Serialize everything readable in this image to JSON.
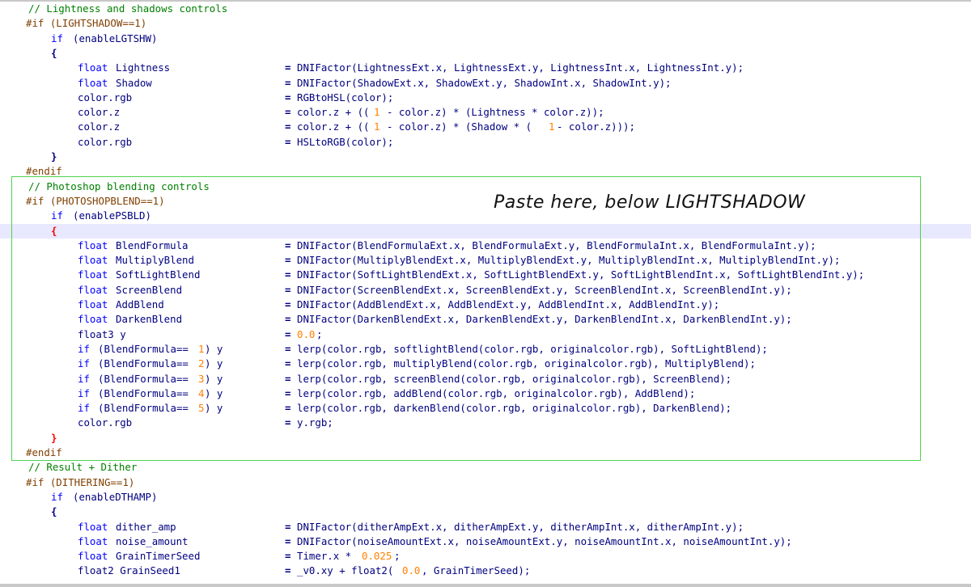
{
  "annotation": {
    "text": "Paste here, below LIGHTSHADOW",
    "box_color": "#4fd24f"
  },
  "colors": {
    "comment": "#008000",
    "preprocessor": "#804000",
    "keyword": "#0000ff",
    "identifier": "#000080",
    "number": "#ff8000",
    "matched_brace": "#ff0000",
    "current_line": "#e8e8ff"
  },
  "current_line_index": 15,
  "lines": [
    {
      "segs": [
        {
          "t": "// Lightness and shadows controls",
          "c": "cm",
          "col": 35
        }
      ]
    },
    {
      "segs": [
        {
          "t": "#if (LIGHTSHADOW==1)",
          "c": "pp",
          "col": 32
        }
      ]
    },
    {
      "segs": [
        {
          "t": "if",
          "c": "kw",
          "col": 63
        },
        {
          "t": "(enableLGTSHW)",
          "c": "id",
          "col": 90
        }
      ]
    },
    {
      "segs": [
        {
          "t": "{",
          "c": "br",
          "col": 63
        }
      ]
    },
    {
      "segs": [
        {
          "t": "float",
          "c": "tp",
          "col": 96
        },
        {
          "t": "Lightness",
          "c": "id",
          "col": 143
        },
        {
          "t": "=",
          "c": "op",
          "col": 352
        },
        {
          "t": "DNIFactor(LightnessExt.x, LightnessExt.y, LightnessInt.x, LightnessInt.y);",
          "c": "id",
          "col": 367
        }
      ]
    },
    {
      "segs": [
        {
          "t": "float",
          "c": "tp",
          "col": 96
        },
        {
          "t": "Shadow",
          "c": "id",
          "col": 143
        },
        {
          "t": "=",
          "c": "op",
          "col": 352
        },
        {
          "t": "DNIFactor(ShadowExt.x, ShadowExt.y, ShadowInt.x, ShadowInt.y);",
          "c": "id",
          "col": 367
        }
      ]
    },
    {
      "segs": [
        {
          "t": "color.rgb",
          "c": "id",
          "col": 96
        },
        {
          "t": "=",
          "c": "op",
          "col": 352
        },
        {
          "t": "RGBtoHSL(color);",
          "c": "id",
          "col": 367
        }
      ]
    },
    {
      "segs": [
        {
          "t": "color.z",
          "c": "id",
          "col": 96
        },
        {
          "t": "=",
          "c": "op",
          "col": 352
        },
        {
          "t": "color.z + ((",
          "c": "id",
          "col": 367
        },
        {
          "t": "1",
          "c": "num",
          "col": 462
        },
        {
          "t": "- color.z) * (Lightness * color.z));",
          "c": "id",
          "col": 478
        }
      ]
    },
    {
      "segs": [
        {
          "t": "color.z",
          "c": "id",
          "col": 96
        },
        {
          "t": "=",
          "c": "op",
          "col": 352
        },
        {
          "t": "color.z + ((",
          "c": "id",
          "col": 367
        },
        {
          "t": "1",
          "c": "num",
          "col": 462
        },
        {
          "t": "- color.z) * (Shadow * (",
          "c": "id",
          "col": 478
        },
        {
          "t": "1",
          "c": "num",
          "col": 678
        },
        {
          "t": "- color.z)));",
          "c": "id",
          "col": 688
        }
      ]
    },
    {
      "segs": [
        {
          "t": "color.rgb",
          "c": "id",
          "col": 96
        },
        {
          "t": "=",
          "c": "op",
          "col": 352
        },
        {
          "t": "HSLtoRGB(color);",
          "c": "id",
          "col": 367
        }
      ]
    },
    {
      "segs": [
        {
          "t": "}",
          "c": "br",
          "col": 63
        }
      ]
    },
    {
      "segs": [
        {
          "t": "#endif",
          "c": "pp",
          "col": 32
        }
      ]
    },
    {
      "segs": [
        {
          "t": "// Photoshop blending controls",
          "c": "cm",
          "col": 35
        }
      ]
    },
    {
      "segs": [
        {
          "t": "#if (PHOTOSHOPBLEND==1)",
          "c": "pp",
          "col": 32
        }
      ]
    },
    {
      "segs": [
        {
          "t": "if",
          "c": "kw",
          "col": 63
        },
        {
          "t": "(enablePSBLD)",
          "c": "id",
          "col": 90
        }
      ]
    },
    {
      "segs": [
        {
          "t": "{",
          "c": "brhl",
          "col": 63
        }
      ]
    },
    {
      "segs": [
        {
          "t": "float",
          "c": "tp",
          "col": 96
        },
        {
          "t": "BlendFormula",
          "c": "id",
          "col": 143
        },
        {
          "t": "=",
          "c": "op",
          "col": 352
        },
        {
          "t": "DNIFactor(BlendFormulaExt.x, BlendFormulaExt.y, BlendFormulaInt.x, BlendFormulaInt.y);",
          "c": "id",
          "col": 367
        }
      ]
    },
    {
      "segs": [
        {
          "t": "float",
          "c": "tp",
          "col": 96
        },
        {
          "t": "MultiplyBlend",
          "c": "id",
          "col": 143
        },
        {
          "t": "=",
          "c": "op",
          "col": 352
        },
        {
          "t": "DNIFactor(MultiplyBlendExt.x, MultiplyBlendExt.y, MultiplyBlendInt.x, MultiplyBlendInt.y);",
          "c": "id",
          "col": 367
        }
      ]
    },
    {
      "segs": [
        {
          "t": "float",
          "c": "tp",
          "col": 96
        },
        {
          "t": "SoftLightBlend",
          "c": "id",
          "col": 143
        },
        {
          "t": "=",
          "c": "op",
          "col": 352
        },
        {
          "t": "DNIFactor(SoftLightBlendExt.x, SoftLightBlendExt.y, SoftLightBlendInt.x, SoftLightBlendInt.y);",
          "c": "id",
          "col": 367
        }
      ]
    },
    {
      "segs": [
        {
          "t": "float",
          "c": "tp",
          "col": 96
        },
        {
          "t": "ScreenBlend",
          "c": "id",
          "col": 143
        },
        {
          "t": "=",
          "c": "op",
          "col": 352
        },
        {
          "t": "DNIFactor(ScreenBlendExt.x, ScreenBlendExt.y, ScreenBlendInt.x, ScreenBlendInt.y);",
          "c": "id",
          "col": 367
        }
      ]
    },
    {
      "segs": [
        {
          "t": "float",
          "c": "tp",
          "col": 96
        },
        {
          "t": "AddBlend",
          "c": "id",
          "col": 143
        },
        {
          "t": "=",
          "c": "op",
          "col": 352
        },
        {
          "t": "DNIFactor(AddBlendExt.x, AddBlendExt.y, AddBlendInt.x, AddBlendInt.y);",
          "c": "id",
          "col": 367
        }
      ]
    },
    {
      "segs": [
        {
          "t": "float",
          "c": "tp",
          "col": 96
        },
        {
          "t": "DarkenBlend",
          "c": "id",
          "col": 143
        },
        {
          "t": "=",
          "c": "op",
          "col": 352
        },
        {
          "t": "DNIFactor(DarkenBlendExt.x, DarkenBlendExt.y, DarkenBlendInt.x, DarkenBlendInt.y);",
          "c": "id",
          "col": 367
        }
      ]
    },
    {
      "segs": [
        {
          "t": "float3 y",
          "c": "id",
          "col": 96
        },
        {
          "t": "=",
          "c": "op",
          "col": 352
        },
        {
          "t": "0.0",
          "c": "num",
          "col": 367
        },
        {
          "t": ";",
          "c": "id",
          "col": 391
        }
      ]
    },
    {
      "segs": [
        {
          "t": "if",
          "c": "kw",
          "col": 96
        },
        {
          "t": "(BlendFormula==",
          "c": "id",
          "col": 121
        },
        {
          "t": "1",
          "c": "num",
          "col": 245
        },
        {
          "t": ") y",
          "c": "id",
          "col": 253
        },
        {
          "t": "=",
          "c": "op",
          "col": 352
        },
        {
          "t": "lerp(color.rgb, softlightBlend(color.rgb, originalcolor.rgb), SoftLightBlend);",
          "c": "id",
          "col": 367
        }
      ]
    },
    {
      "segs": [
        {
          "t": "if",
          "c": "kw",
          "col": 96
        },
        {
          "t": "(BlendFormula==",
          "c": "id",
          "col": 121
        },
        {
          "t": "2",
          "c": "num",
          "col": 245
        },
        {
          "t": ") y",
          "c": "id",
          "col": 253
        },
        {
          "t": "=",
          "c": "op",
          "col": 352
        },
        {
          "t": "lerp(color.rgb, multiplyBlend(color.rgb, originalcolor.rgb), MultiplyBlend);",
          "c": "id",
          "col": 367
        }
      ]
    },
    {
      "segs": [
        {
          "t": "if",
          "c": "kw",
          "col": 96
        },
        {
          "t": "(BlendFormula==",
          "c": "id",
          "col": 121
        },
        {
          "t": "3",
          "c": "num",
          "col": 245
        },
        {
          "t": ") y",
          "c": "id",
          "col": 253
        },
        {
          "t": "=",
          "c": "op",
          "col": 352
        },
        {
          "t": "lerp(color.rgb, screenBlend(color.rgb, originalcolor.rgb), ScreenBlend);",
          "c": "id",
          "col": 367
        }
      ]
    },
    {
      "segs": [
        {
          "t": "if",
          "c": "kw",
          "col": 96
        },
        {
          "t": "(BlendFormula==",
          "c": "id",
          "col": 121
        },
        {
          "t": "4",
          "c": "num",
          "col": 245
        },
        {
          "t": ") y",
          "c": "id",
          "col": 253
        },
        {
          "t": "=",
          "c": "op",
          "col": 352
        },
        {
          "t": "lerp(color.rgb, addBlend(color.rgb, originalcolor.rgb), AddBlend);",
          "c": "id",
          "col": 367
        }
      ]
    },
    {
      "segs": [
        {
          "t": "if",
          "c": "kw",
          "col": 96
        },
        {
          "t": "(BlendFormula==",
          "c": "id",
          "col": 121
        },
        {
          "t": "5",
          "c": "num",
          "col": 245
        },
        {
          "t": ") y",
          "c": "id",
          "col": 253
        },
        {
          "t": "=",
          "c": "op",
          "col": 352
        },
        {
          "t": "lerp(color.rgb, darkenBlend(color.rgb, originalcolor.rgb), DarkenBlend);",
          "c": "id",
          "col": 367
        }
      ]
    },
    {
      "segs": [
        {
          "t": "color.rgb",
          "c": "id",
          "col": 96
        },
        {
          "t": "=",
          "c": "op",
          "col": 352
        },
        {
          "t": "y.rgb;",
          "c": "id",
          "col": 367
        }
      ]
    },
    {
      "segs": [
        {
          "t": "}",
          "c": "brhl",
          "col": 63
        }
      ]
    },
    {
      "segs": [
        {
          "t": "#endif",
          "c": "pp",
          "col": 32
        }
      ]
    },
    {
      "segs": [
        {
          "t": "// Result + Dither",
          "c": "cm",
          "col": 35
        }
      ]
    },
    {
      "segs": [
        {
          "t": "#if (DITHERING==1)",
          "c": "pp",
          "col": 32
        }
      ]
    },
    {
      "segs": [
        {
          "t": "if",
          "c": "kw",
          "col": 63
        },
        {
          "t": "(enableDTHAMP)",
          "c": "id",
          "col": 90
        }
      ]
    },
    {
      "segs": [
        {
          "t": "{",
          "c": "br",
          "col": 63
        }
      ]
    },
    {
      "segs": [
        {
          "t": "float",
          "c": "tp",
          "col": 96
        },
        {
          "t": "dither_amp",
          "c": "id",
          "col": 143
        },
        {
          "t": "=",
          "c": "op",
          "col": 352
        },
        {
          "t": "DNIFactor(ditherAmpExt.x, ditherAmpExt.y, ditherAmpInt.x, ditherAmpInt.y);",
          "c": "id",
          "col": 367
        }
      ]
    },
    {
      "segs": [
        {
          "t": "float",
          "c": "tp",
          "col": 96
        },
        {
          "t": "noise_amount",
          "c": "id",
          "col": 143
        },
        {
          "t": "=",
          "c": "op",
          "col": 352
        },
        {
          "t": "DNIFactor(noiseAmountExt.x, noiseAmountExt.y, noiseAmountInt.x, noiseAmountInt.y);",
          "c": "id",
          "col": 367
        }
      ]
    },
    {
      "segs": [
        {
          "t": "float",
          "c": "tp",
          "col": 96
        },
        {
          "t": "GrainTimerSeed",
          "c": "id",
          "col": 143
        },
        {
          "t": "=",
          "c": "op",
          "col": 352
        },
        {
          "t": "Timer.x *",
          "c": "id",
          "col": 367
        },
        {
          "t": "0.025",
          "c": "num",
          "col": 447
        },
        {
          "t": ";",
          "c": "id",
          "col": 487
        }
      ]
    },
    {
      "segs": [
        {
          "t": "float2 GrainSeed1",
          "c": "id",
          "col": 96
        },
        {
          "t": "=",
          "c": "op",
          "col": 352
        },
        {
          "t": "_v0.xy + float2(",
          "c": "id",
          "col": 367
        },
        {
          "t": "0.0",
          "c": "num",
          "col": 497
        },
        {
          "t": ", GrainTimerSeed);",
          "c": "id",
          "col": 521
        }
      ]
    }
  ]
}
